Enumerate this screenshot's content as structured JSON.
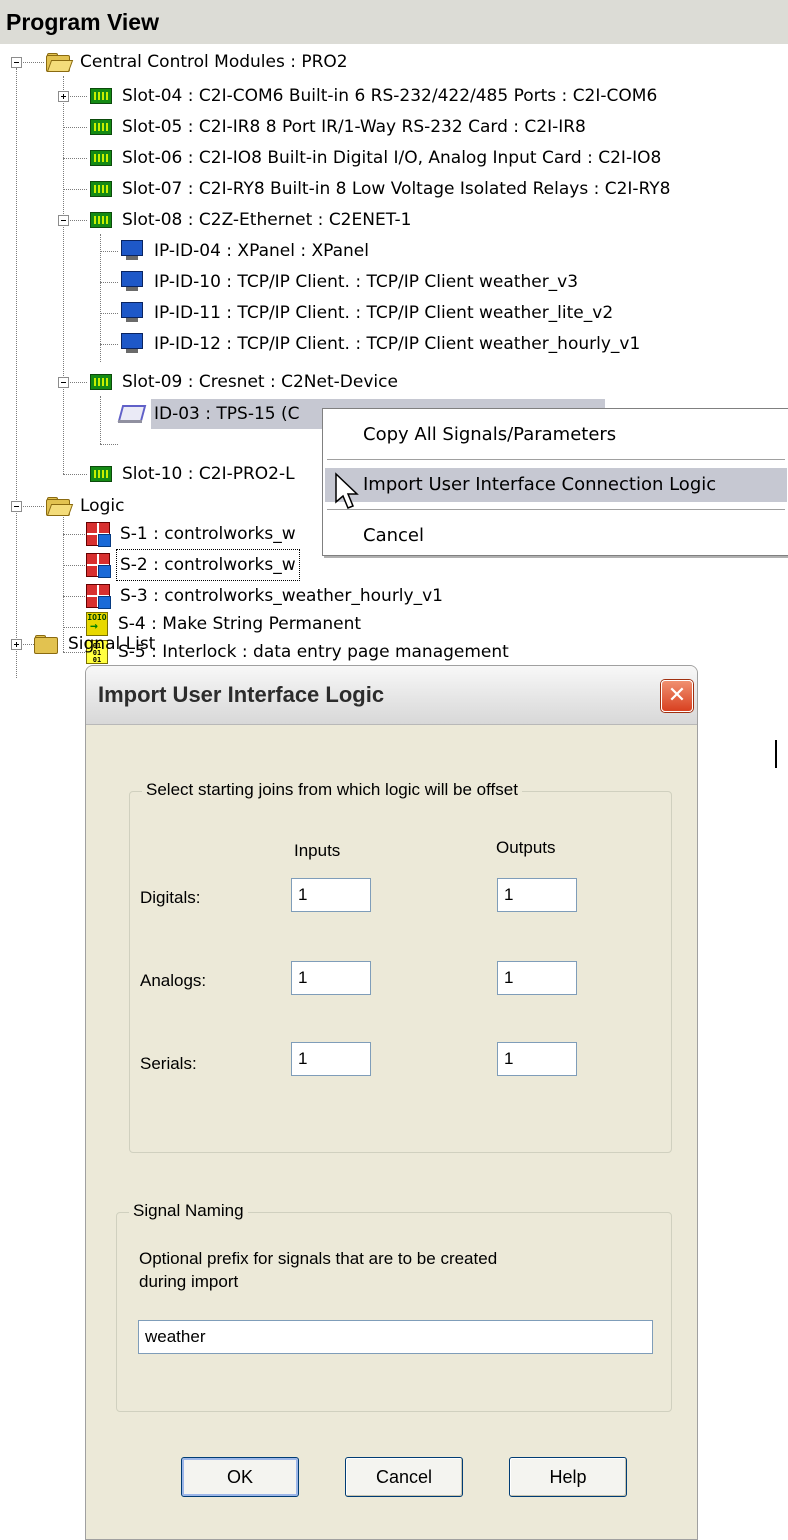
{
  "header": {
    "title": "Program View"
  },
  "tree": {
    "ccm": "Central Control Modules : PRO2",
    "slot04": "Slot-04 : C2I-COM6 Built-in 6 RS-232/422/485 Ports : C2I-COM6",
    "slot05": "Slot-05 : C2I-IR8 8 Port IR/1-Way RS-232 Card : C2I-IR8",
    "slot06": "Slot-06 : C2I-IO8 Built-in Digital I/O, Analog Input Card : C2I-IO8",
    "slot07": "Slot-07 : C2I-RY8 Built-in 8 Low Voltage Isolated Relays : C2I-RY8",
    "slot08": "Slot-08 : C2Z-Ethernet : C2ENET-1",
    "ip04": "IP-ID-04 : XPanel : XPanel",
    "ip10": "IP-ID-10 : TCP/IP Client. : TCP/IP Client weather_v3",
    "ip11": "IP-ID-11 : TCP/IP Client. : TCP/IP Client weather_lite_v2",
    "ip12": "IP-ID-12 : TCP/IP Client. : TCP/IP Client weather_hourly_v1",
    "slot09": "Slot-09 : Cresnet : C2Net-Device",
    "id03": "ID-03 : TPS-15 (C",
    "slot10": "Slot-10 : C2I-PRO2-L",
    "logic": "Logic",
    "s1": "S-1 : controlworks_w",
    "s2": "S-2 : controlworks_w",
    "s3": "S-3 : controlworks_weather_hourly_v1",
    "s4": "S-4 : Make String Permanent",
    "s5": "S-5 : Interlock : data entry page management",
    "signal_list": "Signal List",
    "str_icon_text": "IOIO"
  },
  "context_menu": {
    "items": [
      "Copy All Signals/Parameters",
      "Import User Interface Connection Logic",
      "Cancel"
    ]
  },
  "dialog": {
    "title": "Import User Interface Logic",
    "close_label": "✕",
    "join_group": "Select starting joins from which logic will be offset",
    "inputs_header": "Inputs",
    "outputs_header": "Outputs",
    "rows": [
      {
        "label": "Digitals:",
        "input": "1",
        "output": "1"
      },
      {
        "label": "Analogs:",
        "input": "1",
        "output": "1"
      },
      {
        "label": "Serials:",
        "input": "1",
        "output": "1"
      }
    ],
    "naming_group": "Signal Naming",
    "prefix_label_1": "Optional prefix for signals that are to be created",
    "prefix_label_2": "during import",
    "prefix_value": "weather",
    "ok": "OK",
    "cancel": "Cancel",
    "help": "Help"
  }
}
